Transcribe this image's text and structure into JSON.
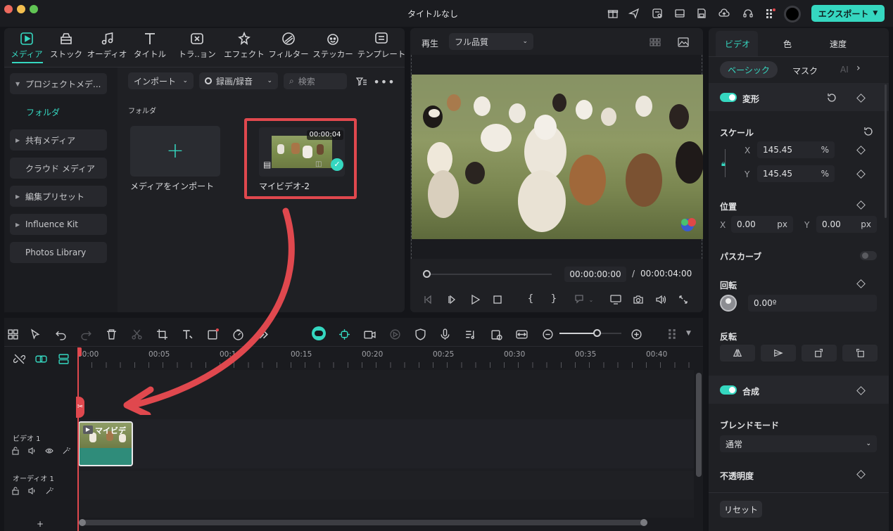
{
  "window": {
    "title": "タイトルなし",
    "export_label": "エクスポート"
  },
  "colors": {
    "accent": "#35d7c0",
    "highlight": "#e0484e",
    "bg": "#141519",
    "panel": "#1f2024"
  },
  "toolbar_tabs": [
    {
      "label": "メディア",
      "icon": "media-icon",
      "active": true
    },
    {
      "label": "ストック",
      "icon": "stock-icon"
    },
    {
      "label": "オーディオ",
      "icon": "audio-icon"
    },
    {
      "label": "タイトル",
      "icon": "title-icon"
    },
    {
      "label": "トラ..ョン",
      "icon": "transition-icon"
    },
    {
      "label": "エフェクト",
      "icon": "effect-icon"
    },
    {
      "label": "フィルター",
      "icon": "filter-icon"
    },
    {
      "label": "ステッカー",
      "icon": "sticker-icon"
    },
    {
      "label": "テンプレート",
      "icon": "template-icon"
    }
  ],
  "sidebar": {
    "items": [
      {
        "label": "プロジェクトメデ..."
      },
      {
        "label": "フォルダ"
      },
      {
        "label": "共有メディア"
      },
      {
        "label": "クラウド メディア"
      },
      {
        "label": "編集プリセット"
      },
      {
        "label": "Influence Kit"
      },
      {
        "label": "Photos Library"
      }
    ]
  },
  "media": {
    "import_label": "インポート",
    "record_label": "録画/録音",
    "search_placeholder": "検索",
    "folder_heading": "フォルダ",
    "import_tile_label": "メディアをインポート",
    "clip_name": "マイビデオ-2",
    "clip_duration": "00:00:04"
  },
  "player": {
    "play_label": "再生",
    "quality": "フル品質",
    "current_time": "00:00:00:00",
    "separator": "/",
    "total_time": "00:00:04:00",
    "progress": 0.0
  },
  "inspector": {
    "tabs": [
      "ビデオ",
      "色",
      "速度"
    ],
    "subtabs": [
      "ベーシック",
      "マスク",
      "AI"
    ],
    "transform_label": "変形",
    "scale_label": "スケール",
    "scale_x_label": "X",
    "scale_x": "145.45",
    "scale_y_label": "Y",
    "scale_y": "145.45",
    "percent": "%",
    "position_label": "位置",
    "pos_x_label": "X",
    "pos_x": "0.00",
    "pos_y_label": "Y",
    "pos_y": "0.00",
    "px": "px",
    "path_curve_label": "パスカーブ",
    "rotation_label": "回転",
    "rotation": "0.00º",
    "flip_label": "反転",
    "composite_label": "合成",
    "blend_label": "ブレンドモード",
    "blend_value": "通常",
    "opacity_label": "不透明度",
    "reset_label": "リセット"
  },
  "timeline": {
    "ruler": [
      "00:00",
      "00:05",
      "00:10",
      "00:15",
      "00:20",
      "00:25",
      "00:30",
      "00:35",
      "00:40"
    ],
    "video_track": "ビデオ 1",
    "audio_track": "オーディオ 1",
    "clip_title": "マイビデ",
    "add_track": "+",
    "zoom_level": 0.6
  }
}
